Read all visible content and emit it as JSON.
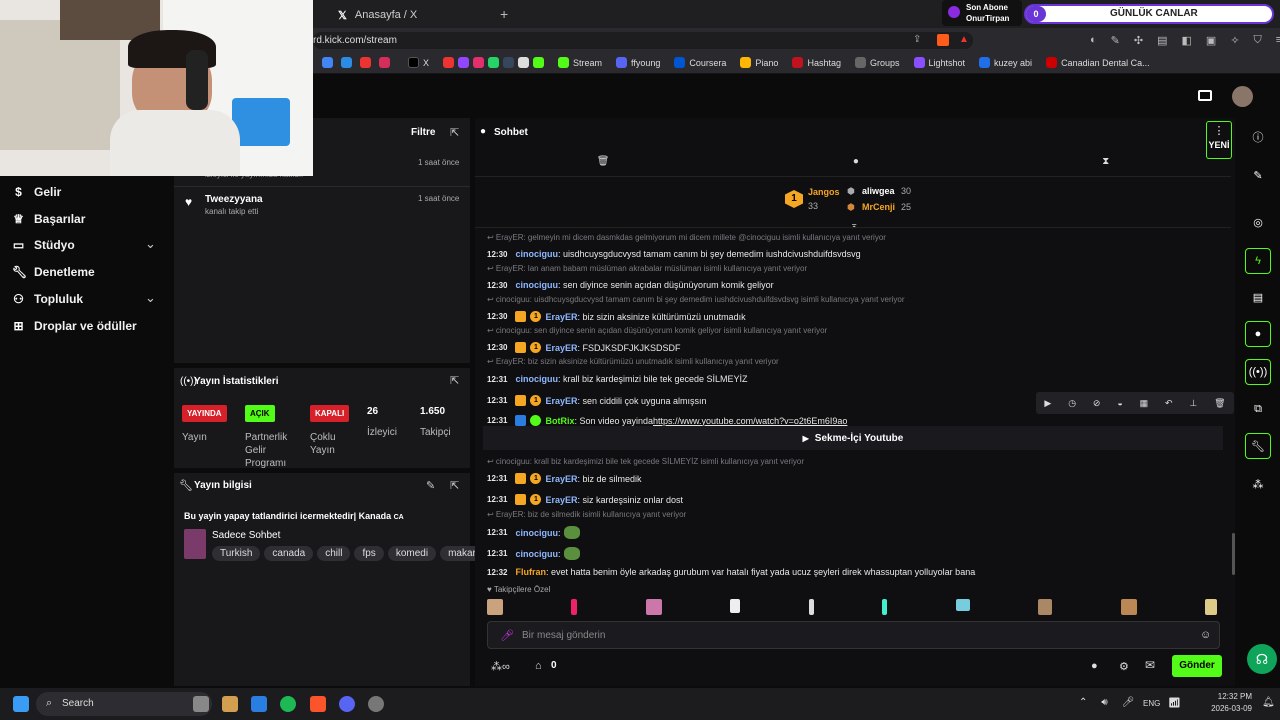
{
  "browser": {
    "tab_title": "Anasayfa / X",
    "url": "rd.kick.com/stream",
    "bookmarks": [
      "X",
      "Stream",
      "ffyoung",
      "Coursera",
      "Piano",
      "Hashtag",
      "Groups",
      "Lightshot",
      "kuzey abi",
      "Canadian Dental Ca..."
    ],
    "widget_subscriber_label": "Son Abone",
    "widget_subscriber_name": "OnurTirpan",
    "widget_count": "0",
    "widget_title": "GÜNLÜK CANLAR"
  },
  "sidebar": {
    "items": [
      {
        "label": "Gelir",
        "icon": "dollar-icon"
      },
      {
        "label": "Başarılar",
        "icon": "trophy-icon"
      },
      {
        "label": "Stüdyo",
        "icon": "studio-icon"
      },
      {
        "label": "Denetleme",
        "icon": "wrench-icon"
      },
      {
        "label": "Topluluk",
        "icon": "community-icon"
      },
      {
        "label": "Droplar ve ödüller",
        "icon": "gift-icon"
      }
    ]
  },
  "activity": {
    "filter_label": "Filtre",
    "items": [
      {
        "name": "",
        "desc": "izleyici ile yayınınıza katıldı!",
        "time": "1 saat önce"
      },
      {
        "name": "Tweezyyana",
        "desc": "kanalı takip etti",
        "time": "1 saat önce"
      }
    ]
  },
  "stats": {
    "title": "Yayın İstatistikleri",
    "badges": [
      {
        "badge": "YAYINDA",
        "label": "Yayın",
        "color": "#d6202a"
      },
      {
        "badge": "AÇIK",
        "label": "Partnerlik Gelir Programı",
        "color": "#53fc18"
      },
      {
        "badge": "KAPALI",
        "label": "Çoklu Yayın",
        "color": "#d6202a"
      }
    ],
    "viewers": "26",
    "viewers_label": "İzleyici",
    "followers": "1.650",
    "followers_label": "Takipçi"
  },
  "stream_info": {
    "title": "Yayın bilgisi",
    "stream_title": "Bu yayin yapay tatlandirici icermektedir| Kanada",
    "flag": "CA",
    "category": "Sadece Sohbet",
    "tags": [
      "Turkish",
      "canada",
      "chill",
      "fps",
      "komedi",
      "makara"
    ]
  },
  "chat": {
    "title": "Sohbet",
    "new_label": "YENİ",
    "leaderboard": [
      {
        "rank": "1",
        "name": "Jangos",
        "count": "33"
      },
      {
        "name": "aliwgea",
        "count": "30"
      },
      {
        "name": "MrCenji",
        "count": "25"
      }
    ],
    "lines": [
      {
        "type": "reply",
        "text": "ErayER: gelmeyin mi dicem dasmkdas gelmiyorum mi dicem millete @cinociguu isimli kullanıcıya yanıt veriyor"
      },
      {
        "type": "msg",
        "time": "12:30",
        "user": "cinociguu",
        "color": "#8fb8ff",
        "text": ": uisdhcuysgducvysd tamam canım bi şey demedim iushdcivushduifdsvdsvg"
      },
      {
        "type": "reply",
        "text": "ErayER: lan anam babam müslüman akrabalar müslüman isimli kullanıcıya yanıt veriyor"
      },
      {
        "type": "msg",
        "time": "12:30",
        "user": "cinociguu",
        "color": "#8fb8ff",
        "text": ": sen diyince senin açıdan düşünüyorum komik geliyor"
      },
      {
        "type": "reply",
        "text": "cinociguu: uisdhcuysgducvysd tamam canım bi şey demedim iushdcivushduifdsvdsvg isimli kullanıcıya yanıt veriyor"
      },
      {
        "type": "msg",
        "time": "12:30",
        "user": "ErayER",
        "color": "#8fb8ff",
        "badges": true,
        "text": ": biz sizin aksinize kültürümüzü unutmadık"
      },
      {
        "type": "reply",
        "text": "cinociguu: sen diyince senin açıdan düşünüyorum komik geliyor isimli kullanıcıya yanıt veriyor"
      },
      {
        "type": "msg",
        "time": "12:30",
        "user": "ErayER",
        "color": "#8fb8ff",
        "badges": true,
        "text": ": FSDJKSDFJKJKSDSDF"
      },
      {
        "type": "reply",
        "text": "ErayER: biz sizin aksinize kültürümüzü unutmadık isimli kullanıcıya yanıt veriyor"
      },
      {
        "type": "msg",
        "time": "12:31",
        "user": "cinociguu",
        "color": "#8fb8ff",
        "text": ": krall biz kardeşimizi bile tek gecede SİLMEYİZ"
      },
      {
        "type": "msg",
        "time": "12:31",
        "user": "ErayER",
        "color": "#8fb8ff",
        "badges": true,
        "text": ": sen ciddili çok uyguna almışsın"
      },
      {
        "type": "msg",
        "time": "12:31",
        "user": "BotRix",
        "color": "#53fc18",
        "bot": true,
        "text": ": Son video yayinda ",
        "link": "https://www.youtube.com/watch?v=o2t6Em6I9ao"
      },
      {
        "type": "card",
        "text": "Sekme-İçi Youtube"
      },
      {
        "type": "reply",
        "text": "cinociguu: krall biz kardeşimizi bile tek gecede SİLMEYİZ isimli kullanıcıya yanıt veriyor"
      },
      {
        "type": "msg",
        "time": "12:31",
        "user": "ErayER",
        "color": "#8fb8ff",
        "badges": true,
        "text": ": biz de silmedik"
      },
      {
        "type": "msg",
        "time": "12:31",
        "user": "ErayER",
        "color": "#8fb8ff",
        "badges": true,
        "text": ": siz kardeşsiniz onlar dost"
      },
      {
        "type": "reply",
        "text": "ErayER: biz de silmedik isimli kullanıcıya yanıt veriyor"
      },
      {
        "type": "msg",
        "time": "12:31",
        "user": "cinociguu",
        "color": "#8fb8ff",
        "text": ":",
        "emote": true
      },
      {
        "type": "msg",
        "time": "12:31",
        "user": "cinociguu",
        "color": "#8fb8ff",
        "text": ":",
        "emote": true
      },
      {
        "type": "msg",
        "time": "12:32",
        "user": "Flufran",
        "color": "#f5a623",
        "text": ": evet hatta benim öyle arkadaş gurubum var hatalı fiyat yada ucuz şeyleri direk whassuptan yolluyolar bana"
      }
    ],
    "followers_only_label": "Takipçilere Özel",
    "input_placeholder": "Bir mesaj gönderin",
    "points": "0",
    "send_label": "Gönder"
  },
  "taskbar": {
    "search_label": "Search",
    "lang": "ENG",
    "time": "12:32 PM",
    "date": "2026-03-09"
  },
  "colors": {
    "accent": "#53fc18",
    "live": "#d6202a",
    "gold": "#f5a623"
  }
}
